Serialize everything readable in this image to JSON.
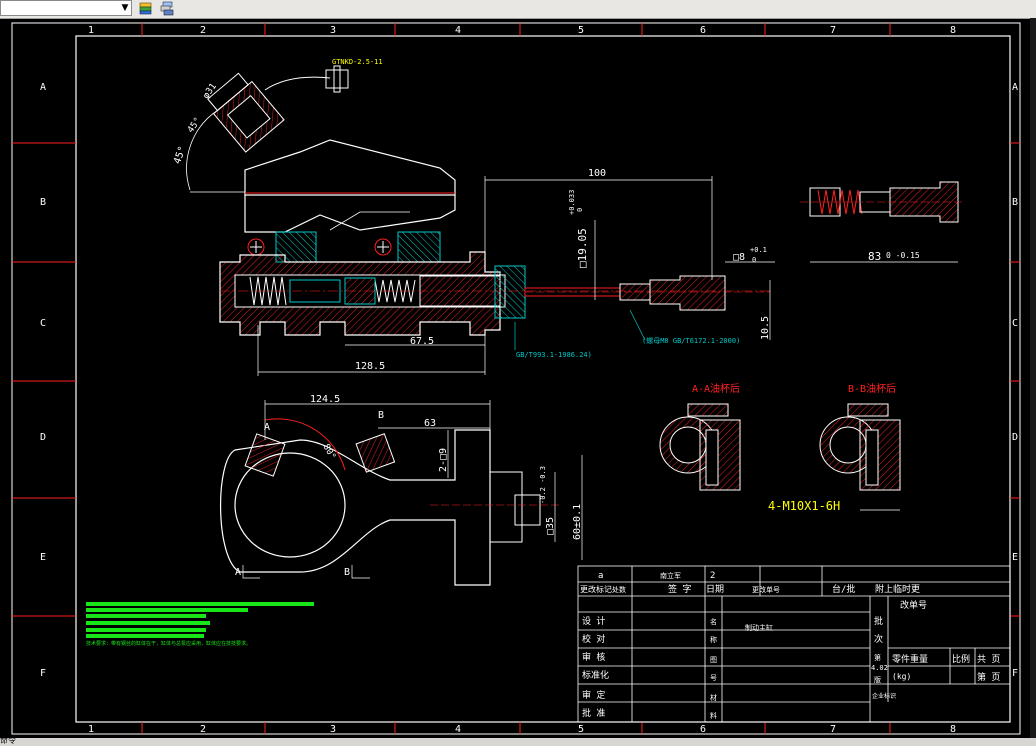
{
  "toolbar": {
    "layer_value": "",
    "icon1": "layers-icon",
    "icon2": "layer-stack-icon"
  },
  "border": {
    "cols": [
      "1",
      "2",
      "3",
      "4",
      "5",
      "6",
      "7",
      "8"
    ],
    "rows": [
      "A",
      "B",
      "C",
      "D",
      "E",
      "F"
    ]
  },
  "dims": {
    "d100": "100",
    "d19": "□19.05",
    "d19_tol_up": "+0.033",
    "d19_tol_lo": "0",
    "d8": "□8",
    "d8_tol_up": "+0.1",
    "d8_tol_lo": "0",
    "d83": "83",
    "d83_tol": "0 -0.15",
    "d105": "10.5",
    "d675": "67.5",
    "d1285": "128.5",
    "d1245": "124.5",
    "d63": "63",
    "d9": "2-□9",
    "d35": "□35",
    "d35_tol": "-0.2 -0.3",
    "d60": "60±0.1",
    "ang45": "45°",
    "ang45b": "45°",
    "ang80": "80°",
    "thread": "4-M10X1-6H",
    "phi31": "φ31",
    "connector": "GTNKD-2.5-11",
    "note_gb1": "GB/T993.1-1986.24)",
    "note_gb2": "(螺母M8 GB/T6172.1-2000)",
    "label_a": "A",
    "label_b": "B",
    "label_a2": "A",
    "label_b2": "B"
  },
  "sections": {
    "aa": "A-A油杯后",
    "bb": "B-B油杯后"
  },
  "notes": {
    "line1": "技术要求：带有钢丝的缸体在干，缸体与总泵应采用，缸体应在技技要求。"
  },
  "title_block": {
    "rev_a": "a",
    "rev_cnt": "2",
    "rev_by": "南立军",
    "r_change": "更改标记",
    "r_count": "处数",
    "r_sign": "签 字",
    "r_date": "日期",
    "r_docno": "更改单号",
    "r_stage": "台/批",
    "r_attach": "附上临时更",
    "r_changeno": "改单号",
    "design": "设 计",
    "check": "校 对",
    "review": "审 核",
    "standard": "标准化",
    "approve_d": "审 定",
    "approve": "批 准",
    "name": "名",
    "title": "称",
    "map": "图",
    "no": "号",
    "mat": "材",
    "mat2": "料",
    "part_name": "制动主缸",
    "batch": "批",
    "batch2": "次",
    "weight_lbl": "零件重量",
    "weight_unit": "(kg)",
    "weight_val": "4.02",
    "scale": "比例",
    "total": "共 页",
    "page": "第 页",
    "company": "企业标识",
    "vert1": "第",
    "vert2": "版"
  },
  "statusbar": {
    "text": "命令"
  },
  "colors": {
    "bg": "#000000",
    "line": "#ffffff",
    "red": "#ff2020",
    "green": "#19e619",
    "yellow": "#ffff00",
    "cyan": "#00c8c8",
    "hatch": "#e02020"
  }
}
